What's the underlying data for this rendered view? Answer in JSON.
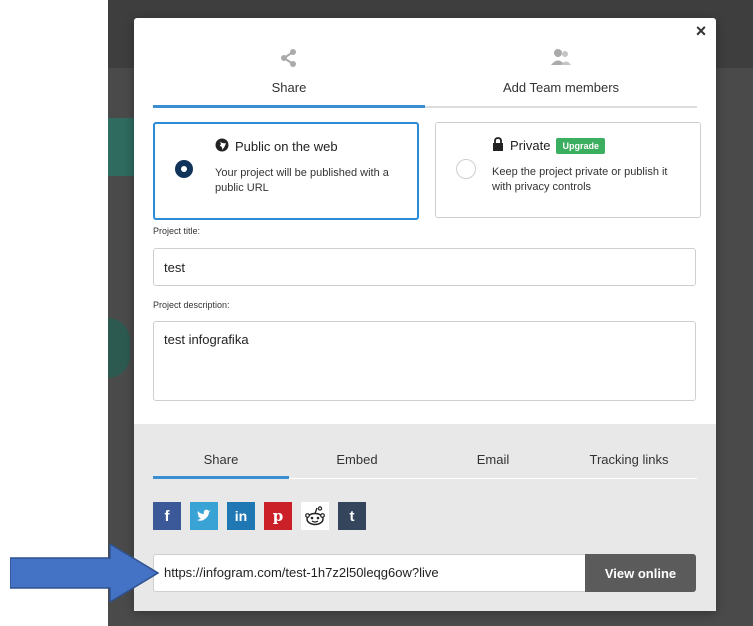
{
  "tabs": [
    {
      "label": "Share",
      "icon": "share-icon",
      "active": true
    },
    {
      "label": "Add Team members",
      "icon": "team-members-icon",
      "active": false
    }
  ],
  "visibility": {
    "public": {
      "title": "Public on the web",
      "description": "Your project will be published with a public URL",
      "selected": true
    },
    "private": {
      "title": "Private",
      "badge": "Upgrade",
      "description": "Keep the project private or publish it with privacy controls",
      "selected": false
    }
  },
  "project": {
    "title_label": "Project title:",
    "title_value": "test",
    "description_label": "Project description:",
    "description_value": "test infografika"
  },
  "share_tabs": [
    {
      "label": "Share",
      "active": true
    },
    {
      "label": "Embed",
      "active": false
    },
    {
      "label": "Email",
      "active": false
    },
    {
      "label": "Tracking links",
      "active": false
    }
  ],
  "socials": [
    {
      "name": "facebook-icon",
      "glyph": "f",
      "color": "#3b5998"
    },
    {
      "name": "twitter-icon",
      "glyph": "t",
      "color": "#3aa3d6"
    },
    {
      "name": "linkedin-icon",
      "glyph": "in",
      "color": "#1f78b4"
    },
    {
      "name": "pinterest-icon",
      "glyph": "p",
      "color": "#cb2027"
    },
    {
      "name": "reddit-icon",
      "glyph": "r",
      "color": "#ffffff"
    },
    {
      "name": "tumblr-icon",
      "glyph": "t",
      "color": "#35465c"
    }
  ],
  "url": "https://infogram.com/test-1h7z2l50leqg6ow?live",
  "view_online_label": "View online",
  "close_label": "×",
  "colors": {
    "accent": "#3a8fd2",
    "radio_selected": "#10335a",
    "upgrade_badge": "#3cae5f",
    "arrow": "#4472c4"
  }
}
